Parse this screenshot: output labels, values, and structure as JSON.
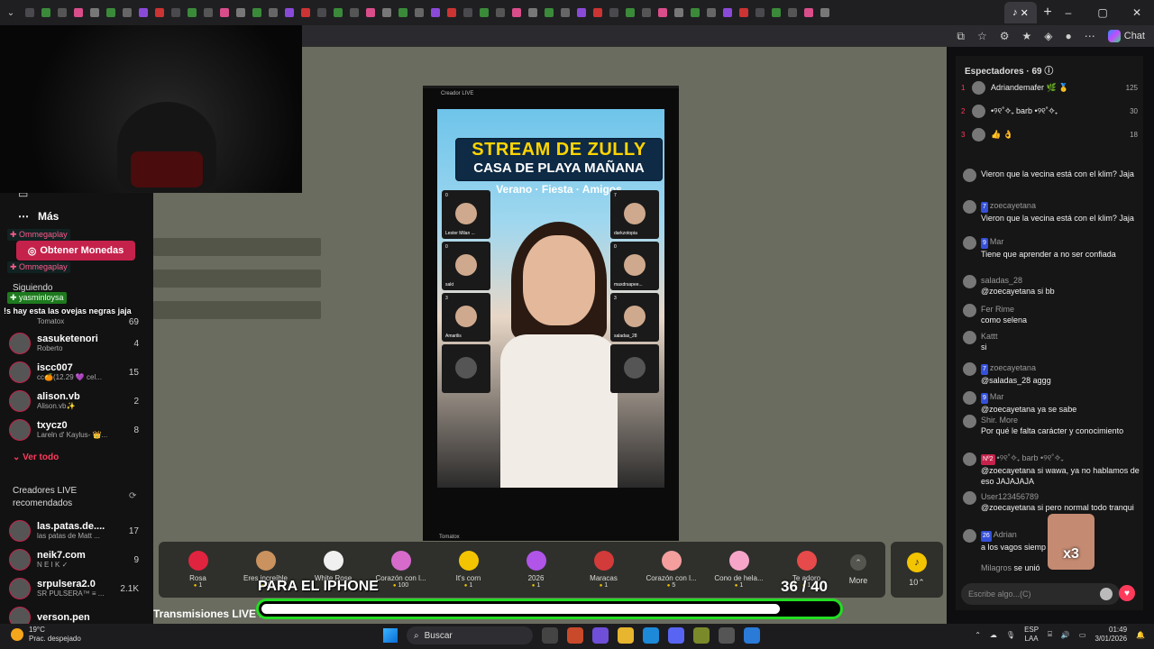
{
  "browser": {
    "active_tab_icon": "tiktok-icon",
    "active_tab_close": "✕",
    "new_tab": "+",
    "window_controls": [
      "–",
      "▢",
      "✕"
    ],
    "chat_label": "Chat"
  },
  "sidebar": {
    "more_label": "Más",
    "coins_button": "Obtener Monedas",
    "overlay_tags": [
      "Ommegaplay",
      "Ommegaplay",
      "yasminloysa"
    ],
    "overlay_text": "!s hay esta las ovejas negras jaja",
    "following_label": "Siguiendo",
    "partial_row": {
      "sub": "Tomatox",
      "count": "69"
    },
    "following": [
      {
        "name": "sasuketenori",
        "sub": "Roberto",
        "count": "4"
      },
      {
        "name": "iscc007",
        "sub": "cc🍊(12.29 💜 cel...",
        "count": "15"
      },
      {
        "name": "alison.vb",
        "sub": "Alison.vb✨",
        "count": "2"
      },
      {
        "name": "txycz0",
        "sub": "Lareln d' Kaylus- 👑...",
        "count": "8"
      }
    ],
    "see_all": "Ver todo",
    "recommended_title": "Creadores LIVE recomendados",
    "recommended": [
      {
        "name": "las.patas.de....",
        "sub": "las patas de Matt ...",
        "count": "17"
      },
      {
        "name": "neik7.com",
        "sub": "N E I K ✓",
        "count": "9"
      },
      {
        "name": "srpulsera2.0",
        "sub": "SR PULSERA™ ≡ ...",
        "count": "2.1K"
      },
      {
        "name": "verson.pen",
        "sub": "",
        "count": ""
      }
    ]
  },
  "main": {
    "bottom_heading": "Transmisiones LIVE recomendadas"
  },
  "stream": {
    "header": "Creador LIVE",
    "title_line1": "STREAM DE ZULLY",
    "title_line2": "CASA DE PLAYA MAÑANA",
    "subtitle": "Verano · Fiesta · Amigos",
    "footer": "Tomatox",
    "guests_left": [
      {
        "name": "Lester Milan ...",
        "count": "0"
      },
      {
        "name": "sakt",
        "count": "0"
      },
      {
        "name": "Amarilis",
        "count": "3"
      },
      {
        "name": "",
        "count": ""
      }
    ],
    "guests_right": [
      {
        "name": "darkzotopia",
        "count": "7"
      },
      {
        "name": "maxdrsapee...",
        "count": "0"
      },
      {
        "name": "saladas_28",
        "count": "3"
      },
      {
        "name": "",
        "count": ""
      }
    ]
  },
  "gifts": [
    {
      "name": "Rosa",
      "price": "1",
      "color": "#e0243f"
    },
    {
      "name": "Eres increíble",
      "price": "1",
      "color": "#c9925f"
    },
    {
      "name": "White Rose",
      "price": "1",
      "color": "#f0f0f0"
    },
    {
      "name": "Corazón con l...",
      "price": "100",
      "color": "#d66bcc"
    },
    {
      "name": "It's corn",
      "price": "1",
      "color": "#f3c400"
    },
    {
      "name": "2026",
      "price": "1",
      "color": "#b055e8"
    },
    {
      "name": "Maracas",
      "price": "1",
      "color": "#d33a3a"
    },
    {
      "name": "Corazón con l...",
      "price": "5",
      "color": "#f49e9e"
    },
    {
      "name": "Cono de hela...",
      "price": "1",
      "color": "#f6a5c8"
    },
    {
      "name": "Te adoro",
      "price": "1",
      "color": "#e74a4a"
    }
  ],
  "gift_more": "More",
  "gift_more_arrow": "⌃",
  "coins": {
    "count": "10⌃"
  },
  "goal": {
    "title": "PARA EL IPHONE",
    "current": 36,
    "target": 40,
    "progress": 0.9,
    "counter_text": "36 / 40",
    "bar_color": "#22dd22"
  },
  "viewers": {
    "title": "Espectadores · 69",
    "top": [
      {
        "rank": "1",
        "name": "Adriandemafer 🌿 🥇",
        "score": "125"
      },
      {
        "rank": "2",
        "name": "•୨୧˚✧₊ barb •୨୧˚✧₊",
        "score": "30"
      },
      {
        "rank": "3",
        "name": "👍 👌",
        "score": "18"
      }
    ]
  },
  "chat": {
    "messages": [
      {
        "user": "",
        "badge": "",
        "text": "Vieron que la vecina está con el klim? Jaja"
      },
      {
        "user": "zoecayetana",
        "badge": "7",
        "text": "Vieron que la vecina está con el klim? Jaja"
      },
      {
        "user": "Mar",
        "badge": "9",
        "text": "Tiene que aprender a no ser confiada"
      },
      {
        "user": "saladas_28",
        "badge": "",
        "text": "@zoecayetana si bb"
      },
      {
        "user": "Fer Rime",
        "badge": "",
        "text": "como selena"
      },
      {
        "user": "Kattt",
        "badge": "",
        "text": "si"
      },
      {
        "user": "zoecayetana",
        "badge": "7",
        "text": "@saladas_28 aggg"
      },
      {
        "user": "Mar",
        "badge": "9",
        "text": "@zoecayetana ya se sabe"
      },
      {
        "user": "Shir. More",
        "badge": "",
        "text": "Por qué le falta carácter y conocimiento"
      },
      {
        "user": "•୨୧˚✧₊ barb •୨୧˚✧₊",
        "badge": "Nº2",
        "text": "@zoecayetana si wawa, ya no hablamos de eso JAJAJAJA"
      },
      {
        "user": "User123456789",
        "badge": "",
        "text": "@zoecayetana si pero normal todo tranqui"
      },
      {
        "user": "Adrian",
        "badge": "26",
        "text": "a los vagos siemp"
      }
    ],
    "join_notice": {
      "user": "Milagros",
      "text": "se unió"
    },
    "input_placeholder": "Escribe algo...(C)",
    "overlay_multiplier": "x3"
  },
  "taskbar": {
    "weather_temp": "19°C",
    "weather_desc": "Prac. despejado",
    "search_label": "Buscar",
    "lang_line1": "ESP",
    "lang_line2": "LAA",
    "time": "01:49",
    "date": "3/01/2026"
  }
}
